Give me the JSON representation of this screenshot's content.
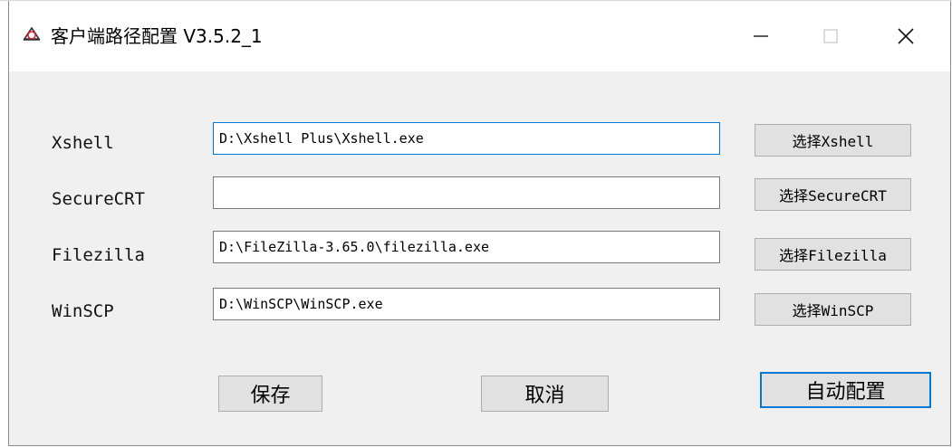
{
  "window": {
    "title": "客户端路径配置 V3.5.2_1",
    "icon": "cloud-app-icon",
    "controls": [
      "minimize",
      "maximize",
      "close"
    ]
  },
  "rows": [
    {
      "label": "Xshell",
      "value": "D:\\Xshell Plus\\Xshell.exe",
      "button": "选择Xshell"
    },
    {
      "label": "SecureCRT",
      "value": "",
      "button": "选择SecureCRT"
    },
    {
      "label": "Filezilla",
      "value": "D:\\FileZilla-3.65.0\\filezilla.exe",
      "button": "选择Filezilla"
    },
    {
      "label": "WinSCP",
      "value": "D:\\WinSCP\\WinSCP.exe",
      "button": "选择WinSCP"
    }
  ],
  "actions": {
    "save": "保存",
    "cancel": "取消",
    "auto_config": "自动配置"
  },
  "colors": {
    "focus_border": "#0078d7",
    "button_face": "#e1e1e1",
    "dialog_bg": "#f0f0f0"
  }
}
